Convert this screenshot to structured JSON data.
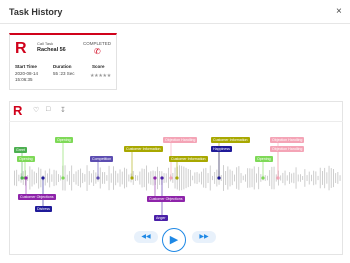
{
  "header": {
    "title": "Task History",
    "close_glyph": "×"
  },
  "card": {
    "logo": "R",
    "task_type": "Call Task",
    "agent_name": "Racheal 56",
    "status": "COMPLETED",
    "phone_icon": "phone-icon",
    "start_time_label": "Start Time",
    "start_date": "2020-08-14",
    "start_clock": "15:06:35",
    "duration_label": "Duration",
    "duration_value": "55 :23 Sec",
    "score_label": "Score",
    "score_stars": "★★★★★",
    "accent": "#d0021b"
  },
  "player": {
    "logo": "R",
    "tools": [
      "heart-icon",
      "comment-icon",
      "download-icon"
    ],
    "controls": {
      "rewind_glyph": "◀◀",
      "play_glyph": "▶",
      "forward_glyph": "▶▶"
    }
  },
  "tags": [
    {
      "label": "Greet",
      "color": "#4caf50"
    },
    {
      "label": "Opening",
      "color": "#7ed957"
    },
    {
      "label": "Opening",
      "color": "#7ed957"
    },
    {
      "label": "Competition",
      "color": "#5c4db1"
    },
    {
      "label": "Customer Information",
      "color": "#a8a800"
    },
    {
      "label": "Customer Information",
      "color": "#a8a800"
    },
    {
      "label": "Objection Handling",
      "color": "#f4a4b6"
    },
    {
      "label": "Customer Information",
      "color": "#a8a800"
    },
    {
      "label": "Happiness",
      "color": "#1f1a99"
    },
    {
      "label": "Objection Handling",
      "color": "#f4a4b6"
    },
    {
      "label": "Objection Handling",
      "color": "#f4a4b6"
    },
    {
      "label": "Opening",
      "color": "#7ed957"
    },
    {
      "label": "Customer Objections",
      "color": "#8e24aa"
    },
    {
      "label": "Distress",
      "color": "#1f1a99"
    },
    {
      "label": "Customer Objections",
      "color": "#8e24aa"
    },
    {
      "label": "Anger",
      "color": "#4a1fa8"
    }
  ]
}
